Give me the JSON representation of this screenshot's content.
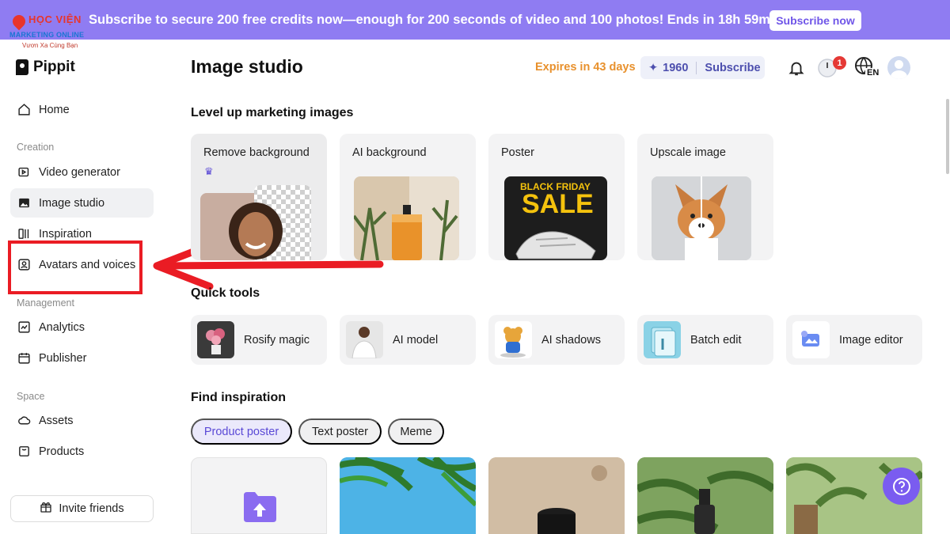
{
  "banner": {
    "text": "Subscribe to secure 200 free credits now—enough for 200 seconds of video and 100 photos! Ends in 18h 59min 46s",
    "button": "Subscribe now"
  },
  "watermark": {
    "line1": "HỌC VIỆN",
    "line2": "MARKETING ONLINE",
    "line3": "Vươn Xa Cùng Bạn"
  },
  "brand": {
    "name": "Pippit"
  },
  "sidebar": {
    "home": "Home",
    "creation_label": "Creation",
    "creation": [
      "Video generator",
      "Image studio",
      "Inspiration",
      "Avatars and voices"
    ],
    "management_label": "Management",
    "management": [
      "Analytics",
      "Publisher"
    ],
    "space_label": "Space",
    "space": [
      "Assets",
      "Products"
    ],
    "invite": "Invite friends"
  },
  "header": {
    "title": "Image studio",
    "expires": "Expires in 43 days",
    "credits": "1960",
    "subscribe": "Subscribe",
    "notification_count": "1",
    "language": "EN"
  },
  "marketing": {
    "title": "Level up marketing images",
    "cards": [
      "Remove background",
      "AI background",
      "Poster",
      "Upscale image"
    ],
    "poster_text_1": "BLACK FRIDAY",
    "poster_text_2": "SALE"
  },
  "quick_tools": {
    "title": "Quick tools",
    "items": [
      "Rosify magic",
      "AI model",
      "AI shadows",
      "Batch edit",
      "Image editor"
    ]
  },
  "inspiration": {
    "title": "Find inspiration",
    "chips": [
      "Product poster",
      "Text poster",
      "Meme"
    ]
  },
  "colors": {
    "banner": "#8f7cf2",
    "accent": "#7a5cf0",
    "expires": "#e8912d",
    "highlight": "#ea1c24"
  }
}
